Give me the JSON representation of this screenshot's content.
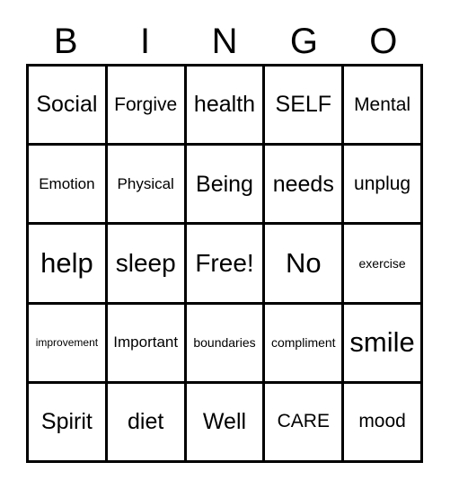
{
  "card": {
    "title": "BINGO",
    "header_letters": [
      "B",
      "I",
      "N",
      "G",
      "O"
    ],
    "grid_size": "5x5",
    "border_color": "#000000",
    "background_color": "#ffffff",
    "text_color": "#000000",
    "free_space": "Free!",
    "rows": [
      [
        {
          "label": "Social",
          "size": "sz-md"
        },
        {
          "label": "Forgive",
          "size": "sz-sm"
        },
        {
          "label": "health",
          "size": "sz-md"
        },
        {
          "label": "SELF",
          "size": "sz-md"
        },
        {
          "label": "Mental",
          "size": "sz-sm"
        }
      ],
      [
        {
          "label": "Emotion",
          "size": "sz-xs"
        },
        {
          "label": "Physical",
          "size": "sz-xs"
        },
        {
          "label": "Being",
          "size": "sz-md"
        },
        {
          "label": "needs",
          "size": "sz-md"
        },
        {
          "label": "unplug",
          "size": "sz-sm"
        }
      ],
      [
        {
          "label": "help",
          "size": "sz-xl"
        },
        {
          "label": "sleep",
          "size": "sz-lg"
        },
        {
          "label": "Free!",
          "size": "sz-lg"
        },
        {
          "label": "No",
          "size": "sz-xl"
        },
        {
          "label": "exercise",
          "size": "sz-xxs"
        }
      ],
      [
        {
          "label": "improvement",
          "size": "sz-tiny"
        },
        {
          "label": "Important",
          "size": "sz-xs"
        },
        {
          "label": "boundaries",
          "size": "sz-xxs"
        },
        {
          "label": "compliment",
          "size": "sz-xxs"
        },
        {
          "label": "smile",
          "size": "sz-xl"
        }
      ],
      [
        {
          "label": "Spirit",
          "size": "sz-md"
        },
        {
          "label": "diet",
          "size": "sz-md"
        },
        {
          "label": "Well",
          "size": "sz-md"
        },
        {
          "label": "CARE",
          "size": "sz-sm"
        },
        {
          "label": "mood",
          "size": "sz-sm"
        }
      ]
    ]
  }
}
